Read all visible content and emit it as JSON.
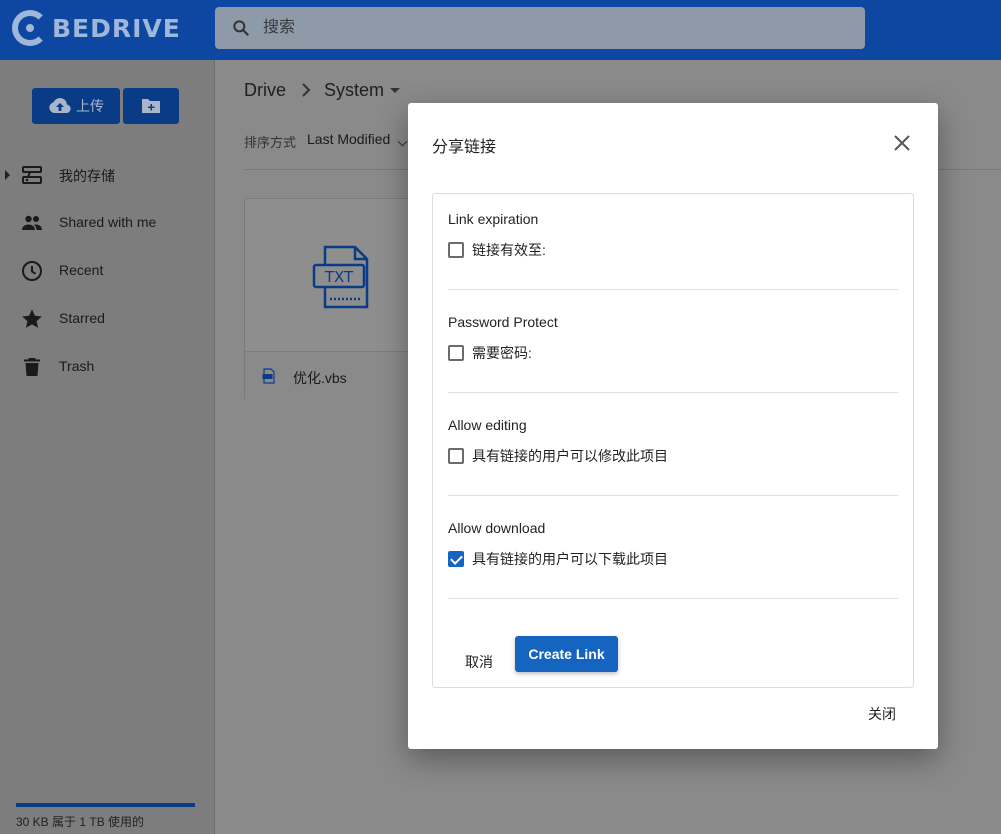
{
  "app": {
    "logo_text": "BEDRIVE"
  },
  "search": {
    "placeholder": "搜索"
  },
  "sidebar": {
    "upload_label": "上传",
    "items": [
      {
        "label": "我的存储",
        "icon": "storage-icon"
      },
      {
        "label": "Shared with me",
        "icon": "people-icon"
      },
      {
        "label": "Recent",
        "icon": "clock-icon"
      },
      {
        "label": "Starred",
        "icon": "star-icon"
      },
      {
        "label": "Trash",
        "icon": "trash-icon"
      }
    ],
    "storage": {
      "text": "30 KB 属于 1 TB 使用的",
      "used_fraction": 3e-05
    }
  },
  "breadcrumb": {
    "root": "Drive",
    "current": "System"
  },
  "sort": {
    "label": "排序方式",
    "value": "Last Modified"
  },
  "files": [
    {
      "name": "优化.vbs",
      "type_badge": "TXT"
    }
  ],
  "dialog": {
    "title": "分享链接",
    "sections": [
      {
        "title": "Link expiration",
        "option_label": "链接有效至:",
        "checked": false
      },
      {
        "title": "Password Protect",
        "option_label": "需要密码:",
        "checked": false
      },
      {
        "title": "Allow editing",
        "option_label": "具有链接的用户可以修改此项目",
        "checked": false
      },
      {
        "title": "Allow download",
        "option_label": "具有链接的用户可以下载此项目",
        "checked": true
      }
    ],
    "cancel_label": "取消",
    "create_label": "Create Link",
    "close_label": "关闭"
  },
  "colors": {
    "brand": "#0d47a1",
    "accent": "#1565c0"
  }
}
